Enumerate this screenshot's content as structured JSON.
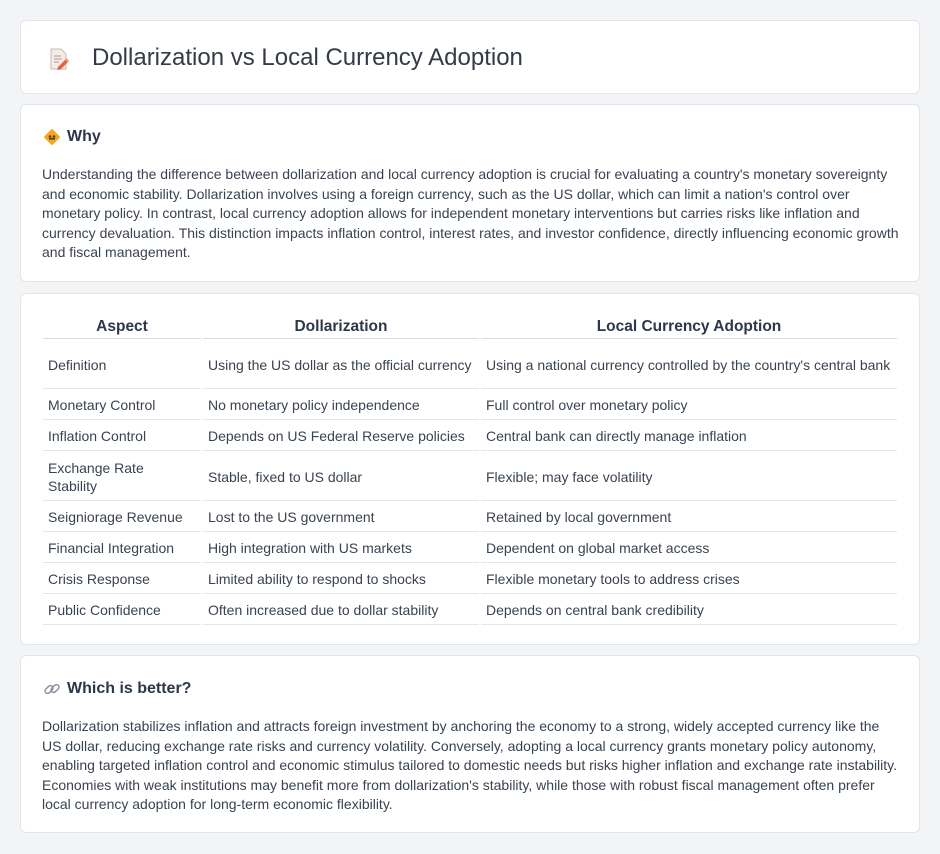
{
  "header": {
    "icon": "document-pencil-icon",
    "title": "Dollarization vs Local Currency Adoption"
  },
  "why": {
    "icon": "diamond-sign-icon",
    "heading": "Why",
    "body": "Understanding the difference between dollarization and local currency adoption is crucial for evaluating a country's monetary sovereignty and economic stability. Dollarization involves using a foreign currency, such as the US dollar, which can limit a nation's control over monetary policy. In contrast, local currency adoption allows for independent monetary interventions but carries risks like inflation and currency devaluation. This distinction impacts inflation control, interest rates, and investor confidence, directly influencing economic growth and fiscal management."
  },
  "comparison": {
    "headers": [
      "Aspect",
      "Dollarization",
      "Local Currency Adoption"
    ],
    "rows": [
      [
        "Definition",
        "Using the US dollar as the official currency",
        "Using a national currency controlled by the country's central bank"
      ],
      [
        "Monetary Control",
        "No monetary policy independence",
        "Full control over monetary policy"
      ],
      [
        "Inflation Control",
        "Depends on US Federal Reserve policies",
        "Central bank can directly manage inflation"
      ],
      [
        "Exchange Rate Stability",
        "Stable, fixed to US dollar",
        "Flexible; may face volatility"
      ],
      [
        "Seigniorage Revenue",
        "Lost to the US government",
        "Retained by local government"
      ],
      [
        "Financial Integration",
        "High integration with US markets",
        "Dependent on global market access"
      ],
      [
        "Crisis Response",
        "Limited ability to respond to shocks",
        "Flexible monetary tools to address crises"
      ],
      [
        "Public Confidence",
        "Often increased due to dollar stability",
        "Depends on central bank credibility"
      ]
    ]
  },
  "which": {
    "icon": "link-icon",
    "heading": "Which is better?",
    "body": "Dollarization stabilizes inflation and attracts foreign investment by anchoring the economy to a strong, widely accepted currency like the US dollar, reducing exchange rate risks and currency volatility. Conversely, adopting a local currency grants monetary policy autonomy, enabling targeted inflation control and economic stimulus tailored to domestic needs but risks higher inflation and exchange rate instability. Economies with weak institutions may benefit more from dollarization's stability, while those with robust fiscal management often prefer local currency adoption for long-term economic flexibility."
  }
}
